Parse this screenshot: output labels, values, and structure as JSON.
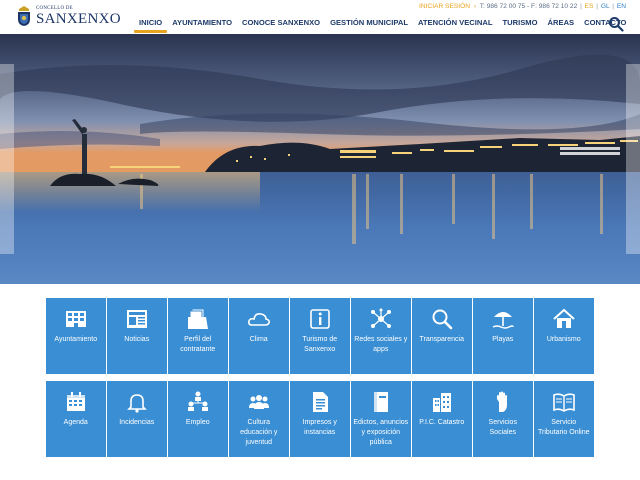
{
  "logo": {
    "small_text": "CONCELLO DE",
    "name": "SANXENXO"
  },
  "utility": {
    "login": "INICIAR SESIÓN",
    "arrow": "›",
    "phone": "T: 986 72 00 75 - F: 986 72 10 22",
    "divider": "|",
    "languages": [
      "ES",
      "GL",
      "EN"
    ]
  },
  "nav": {
    "items": [
      {
        "label": "INICIO",
        "active": true
      },
      {
        "label": "AYUNTAMIENTO",
        "active": false
      },
      {
        "label": "CONOCE SANXENXO",
        "active": false
      },
      {
        "label": "GESTIÓN MUNICIPAL",
        "active": false
      },
      {
        "label": "ATENCIÓN VECINAL",
        "active": false
      },
      {
        "label": "TURISMO",
        "active": false
      },
      {
        "label": "ÁREAS",
        "active": false
      },
      {
        "label": "CONTACTO",
        "active": false
      }
    ],
    "search_icon": "search-icon"
  },
  "tiles": {
    "row1": [
      {
        "label": "Ayuntamiento",
        "icon": "building-icon"
      },
      {
        "label": "Noticias",
        "icon": "newspaper-icon"
      },
      {
        "label": "Perfil del contratante",
        "icon": "folder-documents-icon"
      },
      {
        "label": "Clima",
        "icon": "cloud-sun-icon"
      },
      {
        "label": "Turismo de Sanxenxo",
        "icon": "info-icon"
      },
      {
        "label": "Redes sociales y apps",
        "icon": "network-icon"
      },
      {
        "label": "Transparencia",
        "icon": "magnifier-icon"
      },
      {
        "label": "Playas",
        "icon": "beach-umbrella-icon"
      },
      {
        "label": "Urbanismo",
        "icon": "house-icon"
      }
    ],
    "row2": [
      {
        "label": "Agenda",
        "icon": "calendar-icon"
      },
      {
        "label": "Incidencias",
        "icon": "bell-icon"
      },
      {
        "label": "Empleo",
        "icon": "org-chart-icon"
      },
      {
        "label": "Cultura educación y juventud",
        "icon": "people-group-icon"
      },
      {
        "label": "Impresos y instancias",
        "icon": "document-icon"
      },
      {
        "label": "Edictos, anuncios y exposición pública",
        "icon": "book-icon"
      },
      {
        "label": "P.I.C. Catastro",
        "icon": "city-buildings-icon"
      },
      {
        "label": "Servicios Sociales",
        "icon": "hand-icon"
      },
      {
        "label": "Servicio Tributario Online",
        "icon": "open-book-icon"
      }
    ]
  },
  "colors": {
    "tile": "#3a8ed3",
    "accent": "#e6a31f",
    "nav_text": "#1d3a6a"
  }
}
